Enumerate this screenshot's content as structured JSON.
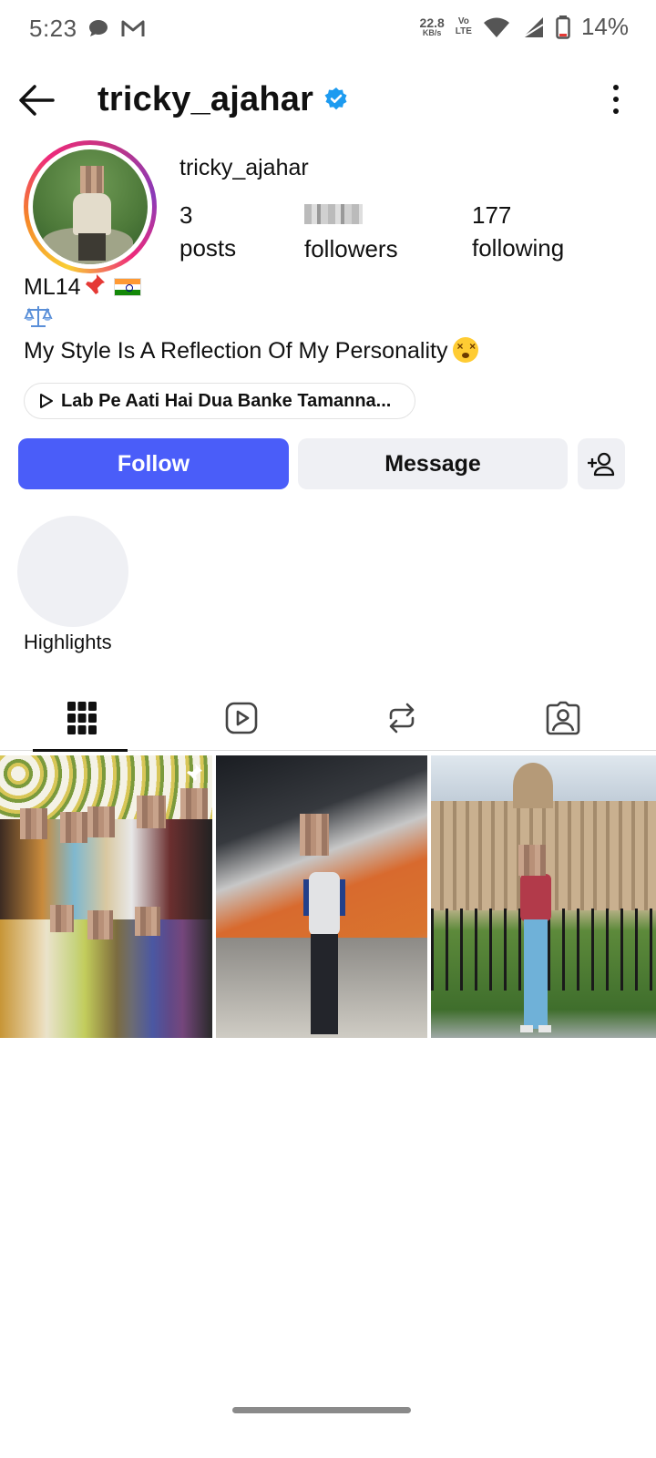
{
  "status_bar": {
    "time": "5:23",
    "net_speed_value": "22.8",
    "net_speed_unit": "KB/s",
    "volte_top": "Vo",
    "volte_bottom": "LTE",
    "battery": "14%",
    "icons": [
      "chat-bubble-icon",
      "gmail-icon",
      "wifi-icon",
      "signal-icon",
      "battery-icon"
    ]
  },
  "header": {
    "title": "tricky_ajahar",
    "verified": true,
    "back_icon": "back-arrow-icon",
    "menu_icon": "more-vertical-icon"
  },
  "profile": {
    "username": "tricky_ajahar",
    "stats": {
      "posts": {
        "value": "3",
        "label": "posts"
      },
      "followers": {
        "value": ",",
        "label": "followers"
      },
      "following": {
        "value": "177",
        "label": "following"
      }
    },
    "bio": {
      "line1": "ML14",
      "line3": "My Style Is A Reflection Of My Personality"
    },
    "music": "Lab Pe Aati Hai Dua Banke Tamanna..."
  },
  "actions": {
    "follow": "Follow",
    "message": "Message"
  },
  "highlights": {
    "label": "Highlights"
  },
  "tabs": [
    {
      "icon": "grid-icon",
      "selected": true
    },
    {
      "icon": "reels-icon",
      "selected": false
    },
    {
      "icon": "reposts-icon",
      "selected": false
    },
    {
      "icon": "tagged-icon",
      "selected": false
    }
  ],
  "colors": {
    "follow_button": "#4a5df9",
    "secondary_button": "#eff0f4",
    "verified_badge": "#1d9bf0"
  }
}
